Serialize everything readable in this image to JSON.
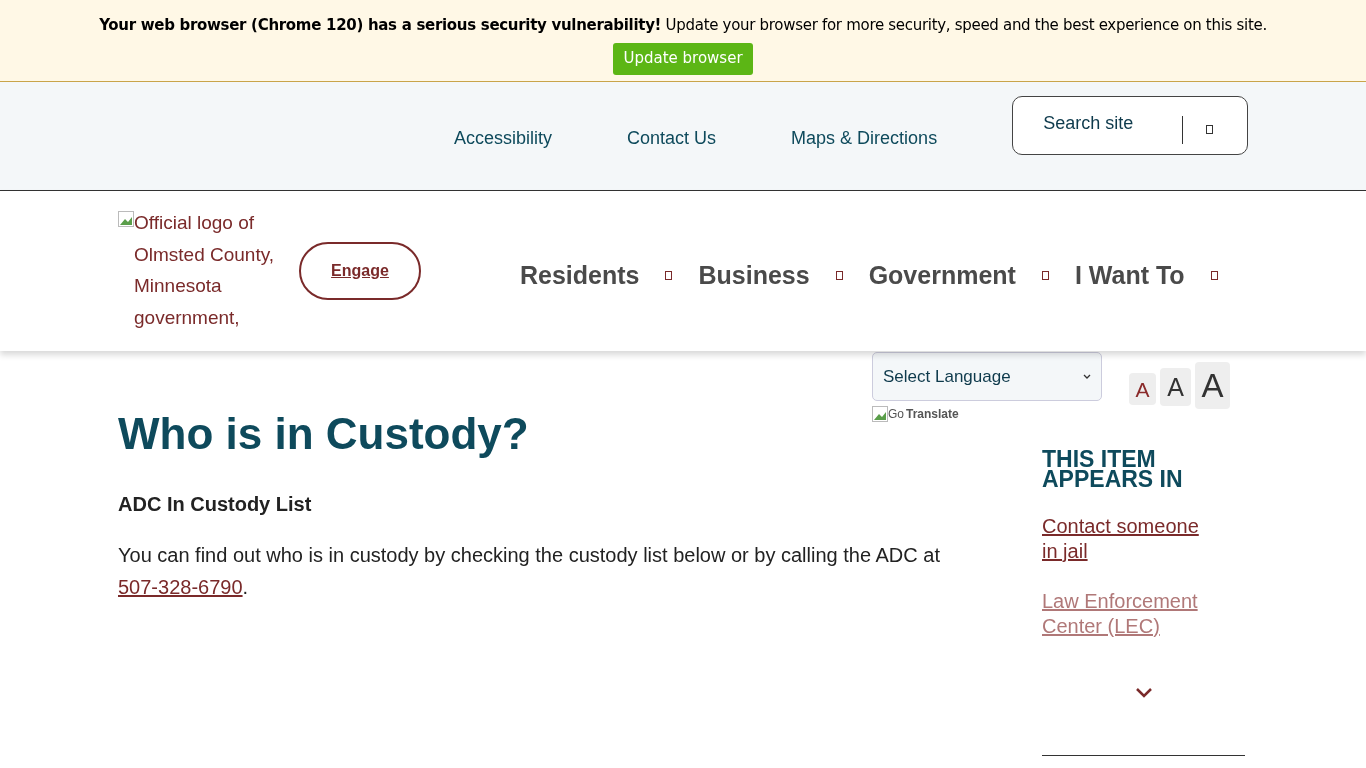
{
  "alert": {
    "bold": "Your web browser (Chrome 120) has a serious security vulnerability!",
    "text": "Update your browser for more security, speed and the best experience on this site.",
    "button": "Update browser"
  },
  "utility_nav": [
    "Accessibility",
    "Contact Us",
    "Maps & Directions"
  ],
  "search": {
    "placeholder": "Search site"
  },
  "logo": {
    "alt": "Official logo of Olmsted County, Minnesota government,"
  },
  "engage_button": "Engage",
  "main_nav": [
    "Residents",
    "Business",
    "Government",
    "I Want To"
  ],
  "language_select": {
    "value": "Select Language"
  },
  "translate": {
    "alt": "Go",
    "label": "Translate"
  },
  "text_sizes": [
    {
      "label": "A",
      "selected": true
    },
    {
      "label": "A",
      "selected": false
    },
    {
      "label": "A",
      "selected": false
    }
  ],
  "page_title": "Who is in Custody?",
  "section_heading": "ADC In Custody List",
  "body": {
    "text": "You can find out who is in custody by checking the custody list below or by calling the ADC at",
    "phone": "507-328-6790",
    "end": "."
  },
  "sidebar": {
    "heading": "THIS ITEM APPEARS IN",
    "links": [
      {
        "label": "Contact someone in jail",
        "faded": false
      },
      {
        "label": "Law Enforcement Center (LEC)",
        "faded": true
      }
    ]
  }
}
